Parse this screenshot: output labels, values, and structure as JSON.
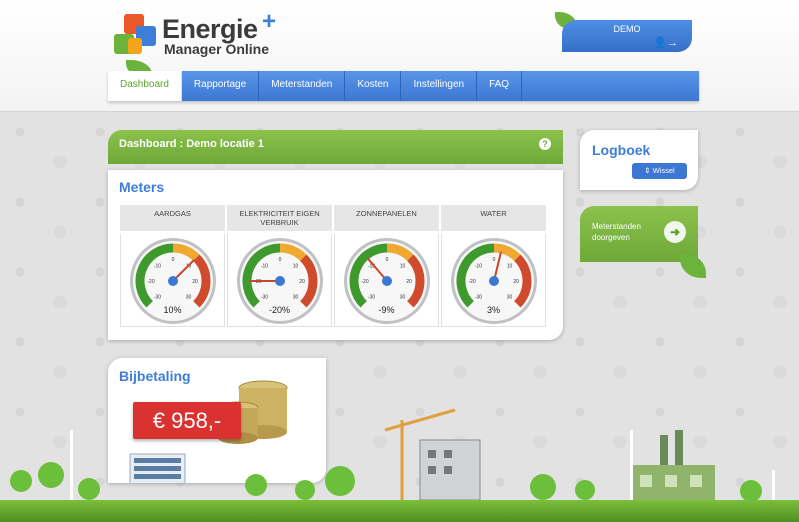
{
  "brand": {
    "title_line1": "Energie",
    "title_line2": "Manager Online",
    "plus": "+"
  },
  "user": {
    "name": "DEMO",
    "logout_icon": "user-logout-icon"
  },
  "nav": {
    "items": [
      {
        "label": "Dashboard",
        "active": true
      },
      {
        "label": "Rapportage",
        "active": false
      },
      {
        "label": "Meterstanden",
        "active": false
      },
      {
        "label": "Kosten",
        "active": false
      },
      {
        "label": "Instellingen",
        "active": false
      },
      {
        "label": "FAQ",
        "active": false
      }
    ]
  },
  "dashboard": {
    "title": "Dashboard : Demo locatie 1",
    "help": "?"
  },
  "meters": {
    "title": "Meters",
    "items": [
      {
        "label": "AARDGAS",
        "value": "10%",
        "percent": 10
      },
      {
        "label": "ELEKTRICITEIT EIGEN VERBRUIK",
        "value": "-20%",
        "percent": -20
      },
      {
        "label": "ZONNEPANELEN",
        "value": "-9%",
        "percent": -9
      },
      {
        "label": "WATER",
        "value": "3%",
        "percent": 3
      }
    ],
    "scale": [
      "-30",
      "-20",
      "-10",
      "0",
      "10",
      "20",
      "30"
    ]
  },
  "logboek": {
    "title": "Logboek",
    "button": "Wissel",
    "button_icon": "sort-arrows-icon"
  },
  "meterstanden_doorgeven": {
    "line1": "Meterstanden",
    "line2": "doorgeven",
    "arrow": "➜"
  },
  "bijbetaling": {
    "title": "Bijbetaling",
    "amount": "€ 958,-"
  },
  "colors": {
    "blue": "#3c78d3",
    "green": "#6ea838",
    "red": "#d93230"
  }
}
